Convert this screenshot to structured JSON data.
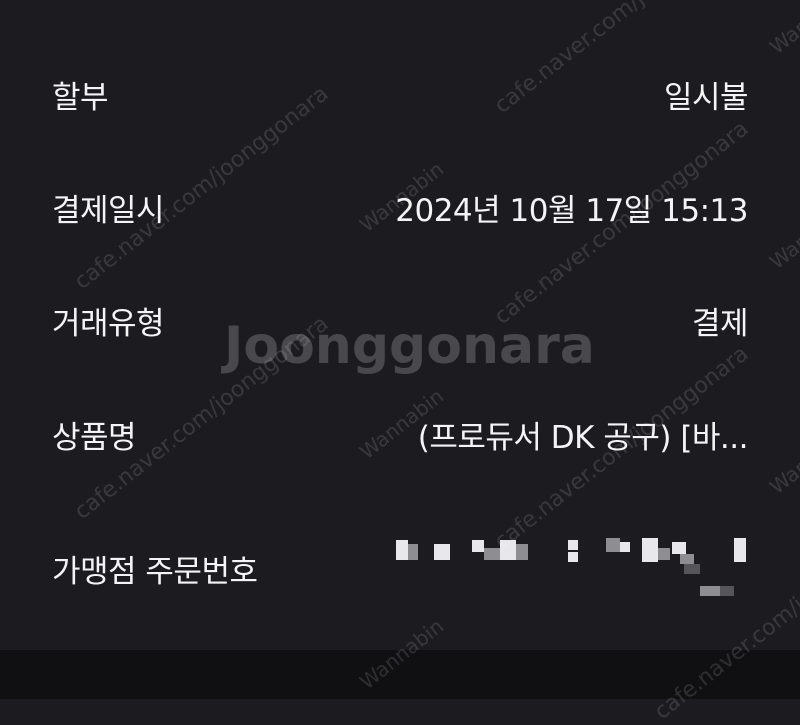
{
  "rows": [
    {
      "label": "할부",
      "value": "일시불"
    },
    {
      "label": "결제일시",
      "value": "2024년 10월 17일 15:13"
    },
    {
      "label": "거래유형",
      "value": "결제"
    },
    {
      "label": "상품명",
      "value": "(프로듀서 DK 공구) [바..."
    },
    {
      "label": "가맹점 주문번호",
      "value": ""
    }
  ],
  "watermark": {
    "logo": "Joonggonara",
    "url": "cafe.naver.com/joonggonara",
    "user": "Wannabin"
  }
}
